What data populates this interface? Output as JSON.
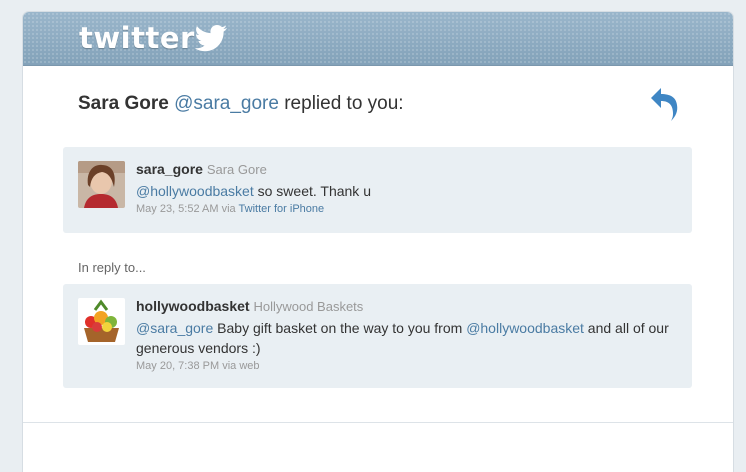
{
  "brand": {
    "logo_text": "twitter"
  },
  "notification": {
    "sender_name": "Sara Gore",
    "sender_handle": "@sara_gore",
    "action_text": "replied to you:"
  },
  "reply_tweet": {
    "username": "sara_gore",
    "full_name": "Sara Gore",
    "mention": "@hollywoodbasket",
    "text": " so sweet. Thank u",
    "timestamp": "May 23, 5:52 AM via ",
    "source": "Twitter for iPhone"
  },
  "in_reply_to_label": "In reply to...",
  "original_tweet": {
    "username": "hollywoodbasket",
    "full_name": "Hollywood Baskets",
    "mention1": "@sara_gore",
    "text1": " Baby gift basket on the way to you from ",
    "mention2": "@hollywoodbasket",
    "text2": " and all of our generous vendors :)",
    "timestamp": "May 20, 7:38 PM via web"
  },
  "colors": {
    "banner": "#8aa8be",
    "link": "#4a7ba3",
    "tweet_bg": "#e9eff3"
  },
  "icons": [
    "twitter-bird-icon",
    "reply-arrow-icon"
  ]
}
